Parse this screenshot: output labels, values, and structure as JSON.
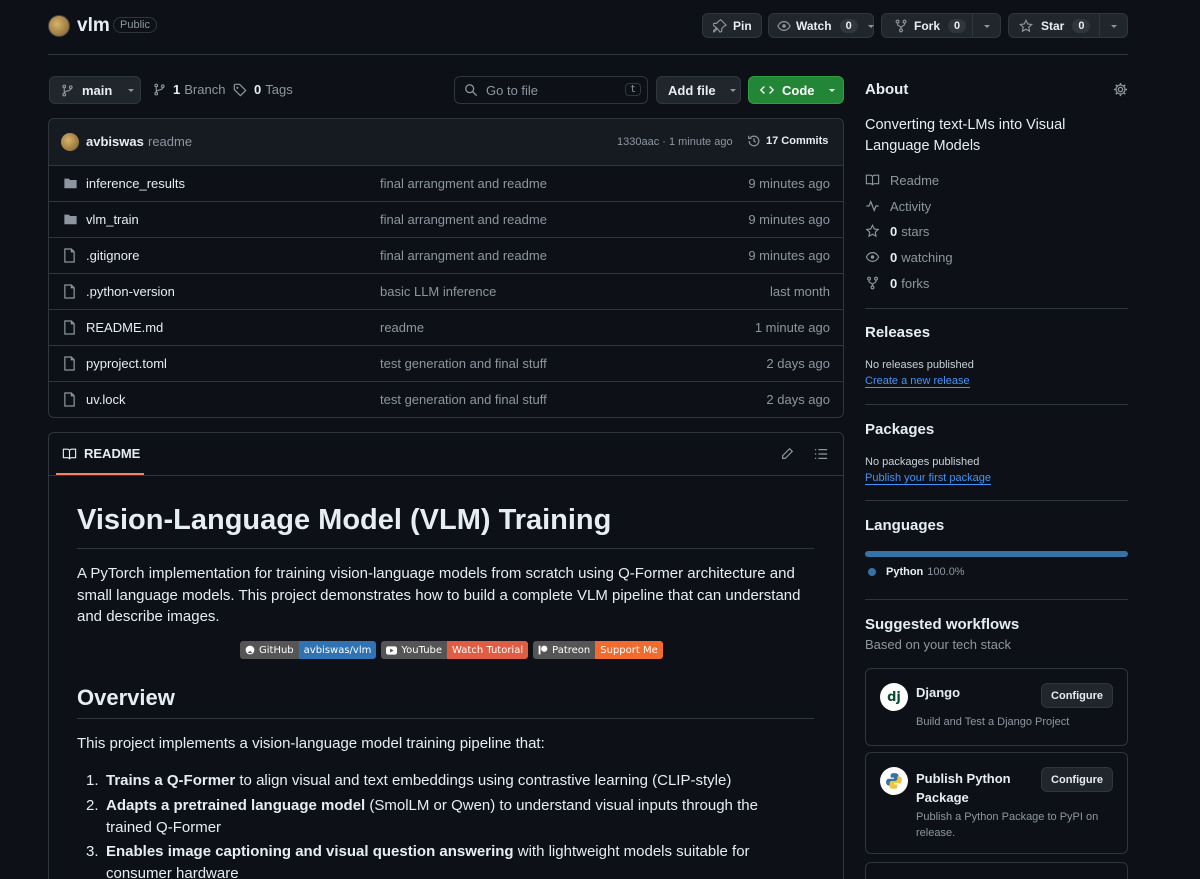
{
  "repo": {
    "name": "vlm",
    "visibility": "Public"
  },
  "actions": {
    "pin": "Pin",
    "watch": "Watch",
    "watch_count": "0",
    "fork": "Fork",
    "fork_count": "0",
    "star": "Star",
    "star_count": "0"
  },
  "toolbar": {
    "branch": "main",
    "branch_count": "1",
    "branch_label": "Branch",
    "tag_count": "0",
    "tag_label": "Tags",
    "search_placeholder": "Go to file",
    "search_key": "t",
    "add_file": "Add file",
    "code": "Code"
  },
  "commit": {
    "author": "avbiswas",
    "message": "readme",
    "hash_time": "1330aac · 1 minute ago",
    "commits": "17 Commits"
  },
  "files": [
    {
      "type": "dir",
      "name": "inference_results",
      "message": "final arrangment and readme",
      "age": "9 minutes ago"
    },
    {
      "type": "dir",
      "name": "vlm_train",
      "message": "final arrangment and readme",
      "age": "9 minutes ago"
    },
    {
      "type": "file",
      "name": ".gitignore",
      "message": "final arrangment and readme",
      "age": "9 minutes ago"
    },
    {
      "type": "file",
      "name": ".python-version",
      "message": "basic LLM inference",
      "age": "last month"
    },
    {
      "type": "file",
      "name": "README.md",
      "message": "readme",
      "age": "1 minute ago"
    },
    {
      "type": "file",
      "name": "pyproject.toml",
      "message": "test generation and final stuff",
      "age": "2 days ago"
    },
    {
      "type": "file",
      "name": "uv.lock",
      "message": "test generation and final stuff",
      "age": "2 days ago"
    }
  ],
  "readme": {
    "tab": "README",
    "title": "Vision-Language Model (VLM) Training",
    "intro": "A PyTorch implementation for training vision-language models from scratch using Q-Former architecture and small language models. This project demonstrates how to build a complete VLM pipeline that can understand and describe images.",
    "badges": [
      {
        "left": "GitHub",
        "right": "avbiswas/vlm",
        "color": "#2f73b4"
      },
      {
        "left": "YouTube",
        "right": "Watch Tutorial",
        "color": "#e05d44"
      },
      {
        "left": "Patreon",
        "right": "Support Me",
        "color": "#f26b2e"
      }
    ],
    "overview_heading": "Overview",
    "overview_text": "This project implements a vision-language model training pipeline that:",
    "list": [
      {
        "num": "1.",
        "bold": "Trains a Q-Former",
        "rest": " to align visual and text embeddings using contrastive learning (CLIP-style)"
      },
      {
        "num": "2.",
        "bold": "Adapts a pretrained language model",
        "rest": " (SmolLM or Qwen) to understand visual inputs through the trained Q-Former"
      },
      {
        "num": "3.",
        "bold": "Enables image captioning and visual question answering",
        "rest": " with lightweight models suitable for consumer hardware"
      }
    ]
  },
  "about": {
    "heading": "About",
    "description": "Converting text-LMs into Visual Language Models",
    "readme": "Readme",
    "activity": "Activity",
    "stars_count": "0",
    "stars_label": "stars",
    "watching_count": "0",
    "watching_label": "watching",
    "forks_count": "0",
    "forks_label": "forks"
  },
  "releases": {
    "heading": "Releases",
    "text": "No releases published",
    "link": "Create a new release"
  },
  "packages": {
    "heading": "Packages",
    "text": "No packages published",
    "link": "Publish your first package"
  },
  "languages": {
    "heading": "Languages",
    "name": "Python",
    "percent": "100.0%",
    "color": "#3572a5",
    "fraction": 1.0
  },
  "workflows": {
    "heading": "Suggested workflows",
    "subheading": "Based on your tech stack",
    "items": [
      {
        "title": "Django",
        "desc": "Build and Test a Django Project",
        "button": "Configure"
      },
      {
        "title": "Publish Python Package",
        "desc": "Publish a Python Package to PyPI on release.",
        "button": "Configure"
      }
    ]
  }
}
